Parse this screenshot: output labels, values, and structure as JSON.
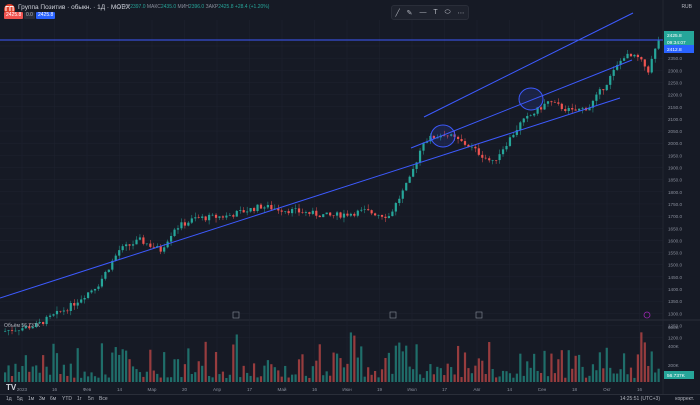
{
  "header": {
    "logo_text": "ГП",
    "symbol": "Группа Позитив · обыкн. · 1Д · MOEX",
    "ohlc": {
      "o_label": "ОТКР",
      "o": "2397.0",
      "h_label": "МАКС",
      "h": "2435.0",
      "l_label": "МИН",
      "l": "2396.0",
      "c_label": "ЗАКР",
      "c": "2425.8",
      "chg": "+28.4 (+1.20%)"
    },
    "price_left": "2425.8",
    "price_mid": "0.0",
    "price_right": "2425.8",
    "currency": "RUB"
  },
  "draw_tools": [
    "pencil-icon",
    "brush-icon",
    "line-icon",
    "text-icon",
    "shape-icon",
    "cursor-icon"
  ],
  "price_axis": [
    "2400.0",
    "2350.0",
    "2300.0",
    "2250.0",
    "2200.0",
    "2150.0",
    "2100.0",
    "2050.0",
    "2000.0",
    "1950.0",
    "1900.0",
    "1850.0",
    "1800.0",
    "1750.0",
    "1700.0",
    "1650.0",
    "1600.0",
    "1550.0",
    "1500.0",
    "1450.0",
    "1400.0",
    "1350.0",
    "1300.0",
    "1250.0",
    "1200.0"
  ],
  "price_tags": {
    "last": "2425.8",
    "countdown": "09:34:07",
    "level": "2412.8"
  },
  "volume": {
    "label": "Объём",
    "value": "56.737K",
    "axis": [
      "600K",
      "400K",
      "200K"
    ],
    "last": "56.737K"
  },
  "time_axis": [
    "2023",
    "16",
    "Фев",
    "14",
    "Мар",
    "20",
    "Апр",
    "17",
    "Май",
    "16",
    "Июн",
    "19",
    "Июл",
    "17",
    "Авг",
    "14",
    "Сен",
    "18",
    "Окт",
    "16"
  ],
  "bottom": {
    "timeframes": [
      "1д",
      "5д",
      "1м",
      "3м",
      "6м",
      "YTD",
      "1г",
      "5л",
      "Все"
    ],
    "clock": "14:25:51 (UTC+3)",
    "correction": "коррект."
  },
  "colors": {
    "up": "#26a69a",
    "down": "#ef5350",
    "line": "#3d5afe",
    "bg": "#161a25"
  }
}
